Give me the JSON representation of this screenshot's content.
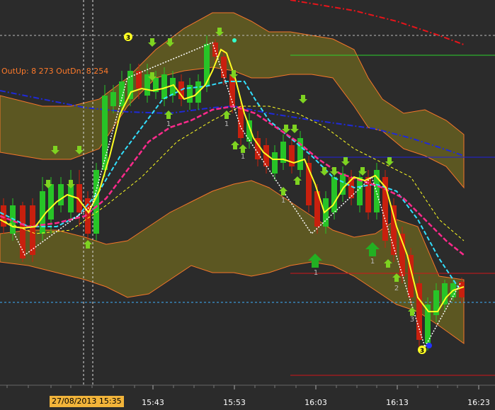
{
  "header": {
    "out_label": "OutUp: 8 273  OutDn: 8 254"
  },
  "cursor": {
    "time_label": "27/08/2013 15:35"
  },
  "colors": {
    "background": "#2b2b2b",
    "bull": "#27c427",
    "bear": "#c8200e",
    "band_fill": "#5f5a22",
    "band_edge": "#ff7a2a",
    "ma_yellow": "#ffff22",
    "ma_cyan": "#33e0ff",
    "ma_pink": "#ff2a8c",
    "ma_blue": "#1f2ad8",
    "ma_red": "#e8141a",
    "arrow_green": "#7ed321",
    "hline_green": "#2ed12e",
    "hline_blue": "#2222e0",
    "hline_red": "#d0141a"
  },
  "chart_data": {
    "type": "candlestick",
    "title": "",
    "xlabel": "",
    "ylabel": "",
    "x_tick_labels": [
      "15:43",
      "15:53",
      "16:03",
      "16:13",
      "16:23"
    ],
    "annotations": [
      "3",
      "3",
      "1",
      "1",
      "1",
      "1",
      "1",
      "1",
      "2",
      "3"
    ],
    "grid": false,
    "series": [
      {
        "name": "",
        "values": []
      }
    ]
  }
}
